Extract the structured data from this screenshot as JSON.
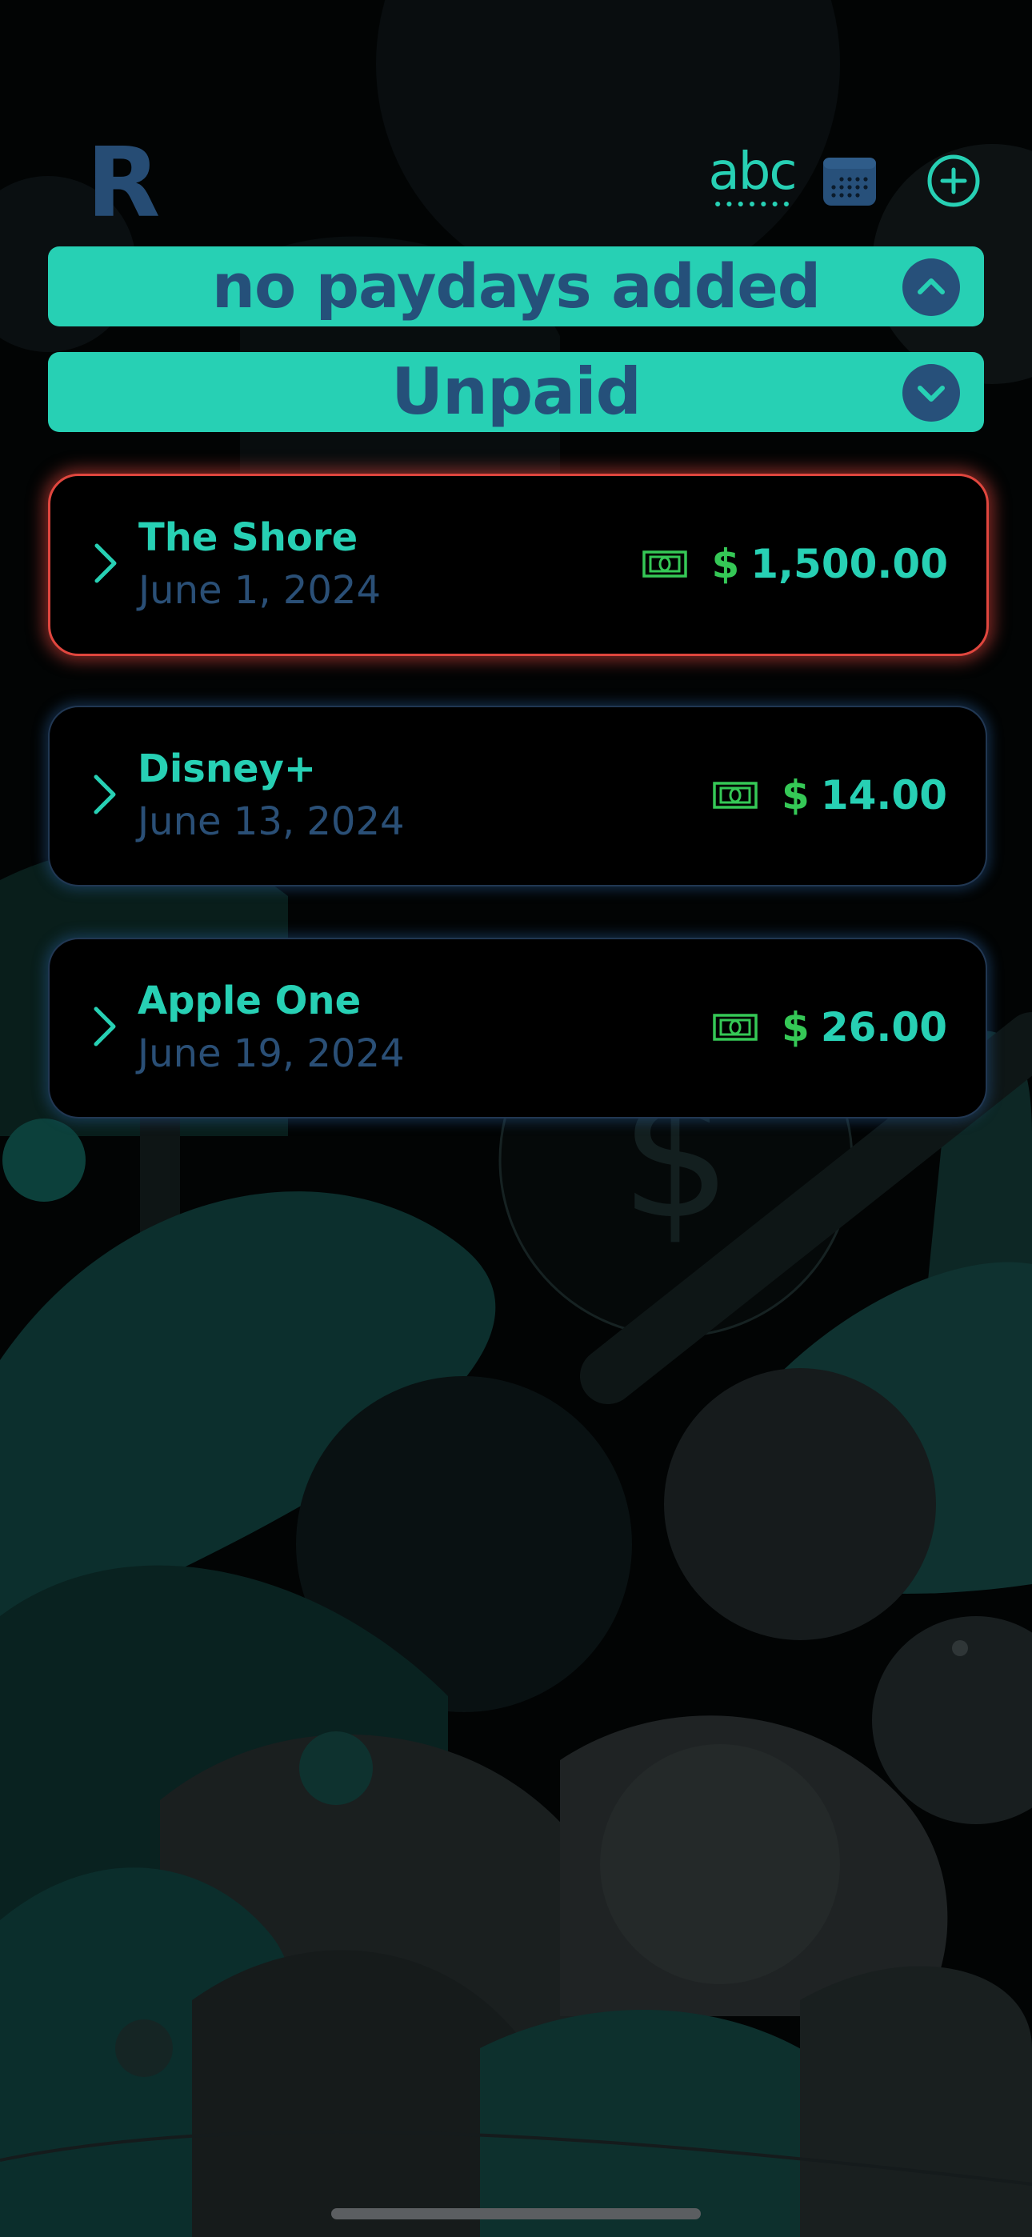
{
  "header": {
    "logo_letter": "R",
    "abc_label": "abc",
    "calendar_icon": "calendar-icon",
    "add_icon": "plus-circle-icon"
  },
  "paydays_banner": {
    "label": "no paydays added",
    "toggle_icon": "chevron-up-icon",
    "expanded": true
  },
  "filter_banner": {
    "label": "Unpaid",
    "toggle_icon": "chevron-down-icon",
    "expanded": false
  },
  "bills": [
    {
      "name": "The Shore",
      "date": "June 1, 2024",
      "currency": "$",
      "amount": "1,500.00",
      "status": "overdue",
      "icon": "cash-icon"
    },
    {
      "name": "Disney+",
      "date": "June 13, 2024",
      "currency": "$",
      "amount": "14.00",
      "status": "upcoming",
      "icon": "cash-icon"
    },
    {
      "name": "Apple One",
      "date": "June 19, 2024",
      "currency": "$",
      "amount": "26.00",
      "status": "upcoming",
      "icon": "cash-icon"
    }
  ],
  "colors": {
    "accent": "#27d0b4",
    "navy": "#27507a",
    "date_text": "#2a4f76",
    "cash_green": "#35c856",
    "overdue_red": "#e0463e",
    "background": "#030506"
  }
}
